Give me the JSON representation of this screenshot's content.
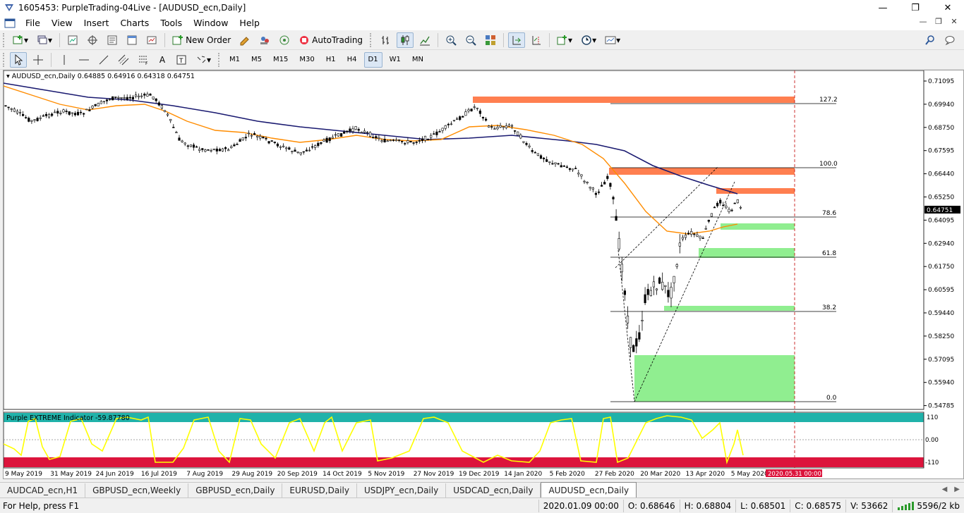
{
  "window": {
    "title": "1605453: PurpleTrading-04Live - [AUDUSD_ecn,Daily]",
    "minimize": "—",
    "maximize": "❐",
    "close": "✕"
  },
  "menu": {
    "items": [
      "File",
      "View",
      "Insert",
      "Charts",
      "Tools",
      "Window",
      "Help"
    ]
  },
  "toolbar": {
    "new_order": "New Order",
    "auto_trading": "AutoTrading"
  },
  "timeframes": [
    "M1",
    "M5",
    "M15",
    "M30",
    "H1",
    "H4",
    "D1",
    "W1",
    "MN"
  ],
  "active_timeframe": "D1",
  "chart": {
    "header": "AUDUSD_ecn,Daily  0.64885 0.64916 0.64318 0.64751",
    "price_labels": [
      "0.71095",
      "0.69940",
      "0.68750",
      "0.67595",
      "0.66440",
      "0.65250",
      "0.64095",
      "0.62940",
      "0.61750",
      "0.60595",
      "0.59440",
      "0.58250",
      "0.57095",
      "0.55940",
      "0.54785"
    ],
    "current_price": "0.64751",
    "date_labels": [
      "9 May 2019",
      "31 May 2019",
      "24 Jun 2019",
      "16 Jul 2019",
      "7 Aug 2019",
      "29 Aug 2019",
      "20 Sep 2019",
      "14 Oct 2019",
      "5 Nov 2019",
      "27 Nov 2019",
      "19 Dec 2019",
      "14 Jan 2020",
      "5 Feb 2020",
      "27 Feb 2020",
      "20 Mar 2020",
      "13 Apr 2020",
      "5 May 2020"
    ],
    "cursor_date": "2020.05.31 00:00",
    "fib_levels": [
      "127.2",
      "100.0",
      "78.6",
      "61.8",
      "38.2",
      "0.0"
    ],
    "indicator": {
      "label": "Purple EXTREME Indicator -59.87780",
      "levels": [
        "110",
        "0.00",
        "-110"
      ]
    },
    "colors": {
      "bull_candle": "#000000",
      "bear_candle": "#000000",
      "ma_fast": "#ff8c00",
      "ma_slow": "#191970",
      "resistance": "#ff7f50",
      "support": "#90ee90",
      "overbought": "#20b2aa",
      "oversold": "#dc143c",
      "oscillator": "#ffff00",
      "cursor_line": "#c00000"
    }
  },
  "tabs": [
    "AUDCAD_ecn,H1",
    "GBPUSD_ecn,Weekly",
    "GBPUSD_ecn,Daily",
    "EURUSD,Daily",
    "USDJPY_ecn,Daily",
    "USDCAD_ecn,Daily",
    "AUDUSD_ecn,Daily"
  ],
  "active_tab": "AUDUSD_ecn,Daily",
  "status": {
    "help": "For Help, press F1",
    "datetime": "2020.01.09 00:00",
    "open": "O: 0.68646",
    "high": "H: 0.68804",
    "low": "L: 0.68501",
    "close": "C: 0.68575",
    "volume": "V: 53662",
    "traffic": "5596/2 kb"
  }
}
